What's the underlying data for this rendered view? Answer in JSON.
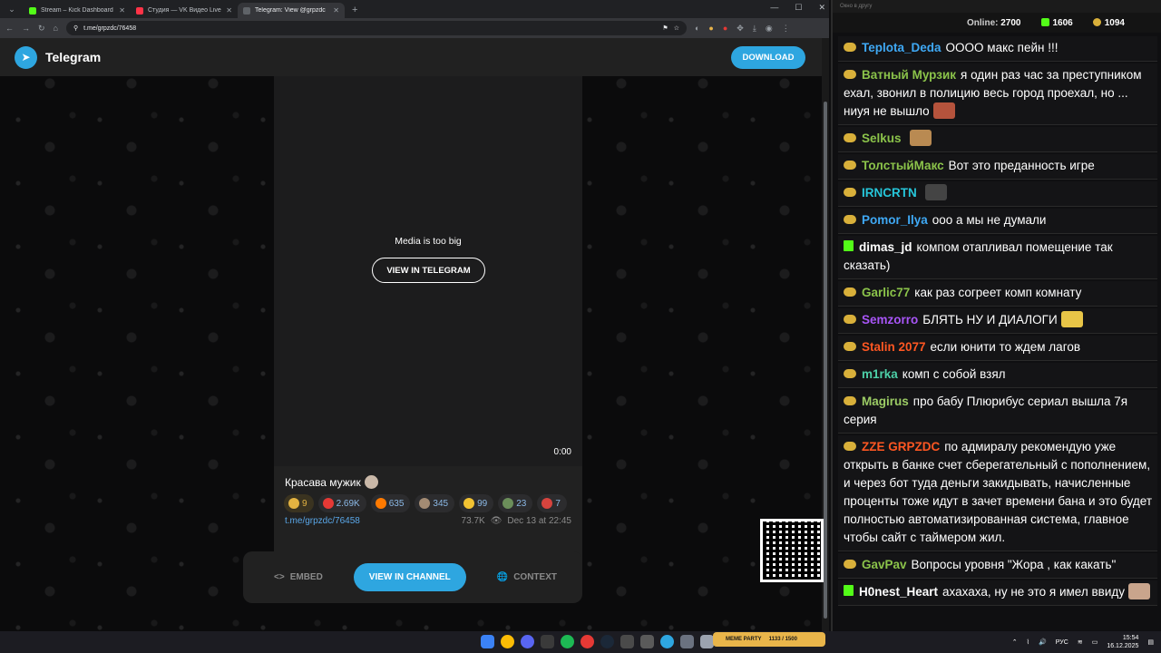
{
  "browser": {
    "tabs": [
      {
        "label": "Stream – Kick Dashboard",
        "color": "#53fc18",
        "active": false
      },
      {
        "label": "Студия — VK Видео Live",
        "color": "#ff3347",
        "active": false
      },
      {
        "label": "Telegram: View @grpzdc",
        "color": "#5f6368",
        "active": true
      }
    ],
    "url": "t.me/grpzdc/76458"
  },
  "telegram": {
    "brand": "Telegram",
    "download_label": "DOWNLOAD",
    "media_message": "Media is too big",
    "view_in_telegram_label": "VIEW IN TELEGRAM",
    "duration": "0:00",
    "caption": "Красава мужик",
    "reactions": [
      {
        "icon": "star-icon",
        "count": "9",
        "color": "#e3b341"
      },
      {
        "icon": "heart-icon",
        "count": "2.69K",
        "color": "#e53935"
      },
      {
        "icon": "fire-icon",
        "count": "635",
        "color": "#ff7a00"
      },
      {
        "icon": "face-emoji-icon",
        "count": "345",
        "color": "#a38b73"
      },
      {
        "icon": "thumbs-up-icon",
        "count": "99",
        "color": "#f1c232"
      },
      {
        "icon": "sticker-icon",
        "count": "23",
        "color": "#6b8e5a"
      },
      {
        "icon": "santa-emoji-icon",
        "count": "7",
        "color": "#d7443e"
      }
    ],
    "post_link": "t.me/grpzdc/76458",
    "views": "73.7K",
    "date": "Dec 13 at 22:45",
    "embed_label": "EMBED",
    "view_in_channel_label": "VIEW IN CHANNEL",
    "context_label": "CONTEXT"
  },
  "chat": {
    "window_title": "Окно в другу",
    "online_label": "Online:",
    "online_count": "2700",
    "kick_count": "1606",
    "vk_count": "1094",
    "messages": [
      {
        "user": "Teplota_Deda",
        "color": "#3fa9f5",
        "badge": "vk",
        "text": "ОООО макс пейн !!!",
        "emote": ""
      },
      {
        "user": "Ватный Мурзик",
        "color": "#8bc34a",
        "badge": "vk",
        "text": "я один раз час за преступником ехал, звонил в полицию весь город проехал, но  ... ниуя не вышло",
        "emote": "#b5533c"
      },
      {
        "user": "Selkus",
        "color": "#8bc34a",
        "badge": "vk",
        "text": "",
        "emote": "#b98a52"
      },
      {
        "user": "ТолстыйМакс",
        "color": "#8bc34a",
        "badge": "vk",
        "text": "Вот это преданность игре",
        "emote": ""
      },
      {
        "user": "IRNCRTN",
        "color": "#26c6da",
        "badge": "vk",
        "text": "",
        "emote": "#444444"
      },
      {
        "user": "Pomor_Ilya",
        "color": "#3fa9f5",
        "badge": "vk",
        "text": "ооо а мы не думали",
        "emote": ""
      },
      {
        "user": "dimas_jd",
        "color": "#ffffff",
        "badge": "kick",
        "text": "компом отапливал помещение так сказать)",
        "emote": ""
      },
      {
        "user": "Garlic77",
        "color": "#8bc34a",
        "badge": "vk",
        "text": "как раз согреет комп комнату",
        "emote": ""
      },
      {
        "user": "Semzorro",
        "color": "#a855f7",
        "badge": "vk",
        "text": "БЛЯТЬ НУ И ДИАЛОГИ",
        "emote": "#e8c547"
      },
      {
        "user": "Stalin 2077",
        "color": "#ff5722",
        "badge": "vk",
        "text": "если юнити то ждем лагов",
        "emote": ""
      },
      {
        "user": "m1rka",
        "color": "#4dd0a8",
        "badge": "vk",
        "text": "комп с собой взял",
        "emote": ""
      },
      {
        "user": "Magirus",
        "color": "#9ccc65",
        "badge": "vk",
        "text": "про бабу Плюрибус сериал вышла 7я серия",
        "emote": ""
      },
      {
        "user": "ZZE  GRPZDC",
        "color": "#ff5722",
        "badge": "vk",
        "text": "по адмиралу рекомендую уже открыть в банке счет сберегательный с пополнением, и через бот туда деньги закидывать, начисленные проценты тоже идут в зачет времени бана и это будет полностью автоматизированная система, главное чтобы сайт с таймером жил.",
        "emote": ""
      },
      {
        "user": "GavPav",
        "color": "#8bc34a",
        "badge": "vk",
        "text": "Вопросы уровня \"Жора , как какать\"",
        "emote": ""
      },
      {
        "user": "H0nest_Heart",
        "color": "#ffffff",
        "badge": "kick",
        "text": "ахахаха, ну не это я имел ввиду",
        "emote": "#c9a58c"
      }
    ]
  },
  "taskbar": {
    "language": "РУС",
    "time": "15:54",
    "date": "16.12.2025",
    "widget_label": "MEME PARTY",
    "widget_value": "1133 / 1500"
  }
}
